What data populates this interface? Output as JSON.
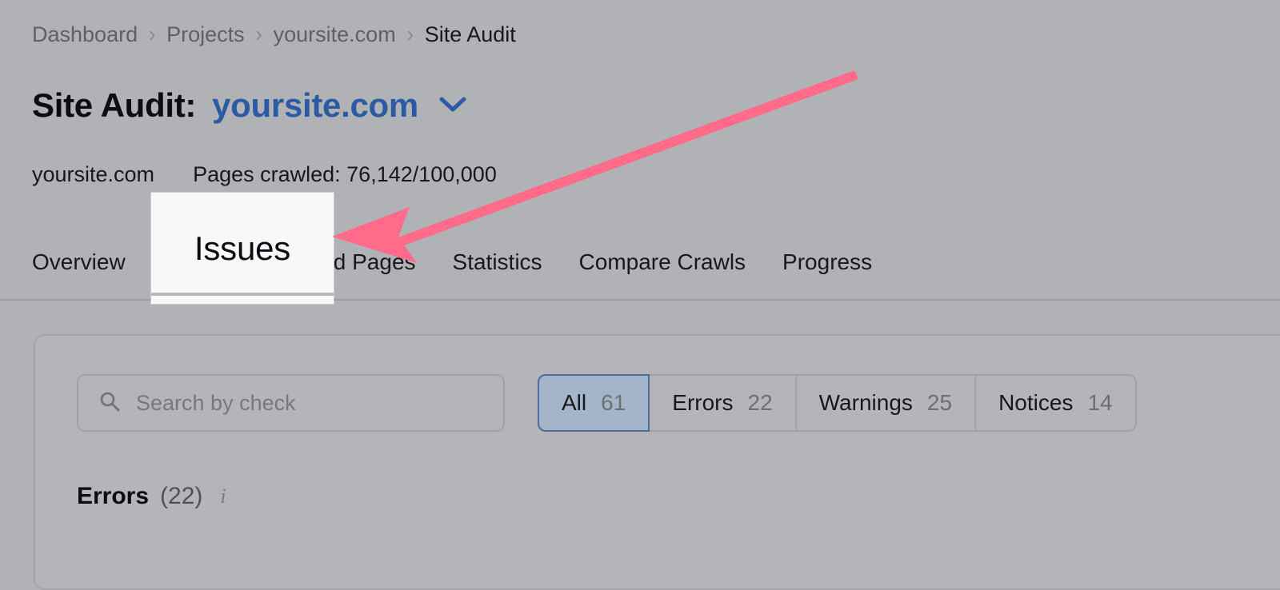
{
  "breadcrumb": {
    "items": [
      {
        "label": "Dashboard"
      },
      {
        "label": "Projects"
      },
      {
        "label": "yoursite.com"
      },
      {
        "label": "Site Audit"
      }
    ],
    "separator": "›"
  },
  "header": {
    "title_label": "Site Audit:",
    "title_domain": "yoursite.com",
    "dropdown_icon": "chevron-down-icon"
  },
  "meta": {
    "domain": "yoursite.com",
    "pages_crawled": "Pages crawled: 76,142/100,000"
  },
  "tabs": [
    {
      "label": "Overview",
      "active": false
    },
    {
      "label": "Issues",
      "active": false
    },
    {
      "label": "Crawled Pages",
      "active": false
    },
    {
      "label": "Statistics",
      "active": false
    },
    {
      "label": "Compare Crawls",
      "active": false
    },
    {
      "label": "Progress",
      "active": false
    }
  ],
  "search": {
    "icon": "search-icon",
    "placeholder": "Search by check",
    "value": ""
  },
  "filters": [
    {
      "label": "All",
      "count": "61",
      "active": true
    },
    {
      "label": "Errors",
      "count": "22",
      "active": false
    },
    {
      "label": "Warnings",
      "count": "25",
      "active": false
    },
    {
      "label": "Notices",
      "count": "14",
      "active": false
    }
  ],
  "section": {
    "title": "Errors",
    "count": "(22)",
    "info_icon": "i"
  },
  "callout": {
    "text": "Issues"
  },
  "annotation": {
    "arrow_color": "#ff6b88",
    "points_to": "Issues"
  },
  "colors": {
    "background": "#b0b2b6",
    "accent_blue": "#2c5aa3",
    "active_filter_bg": "#a4b4c9",
    "active_filter_border": "#4b6e9b",
    "arrow_pink": "#ff6b88"
  }
}
